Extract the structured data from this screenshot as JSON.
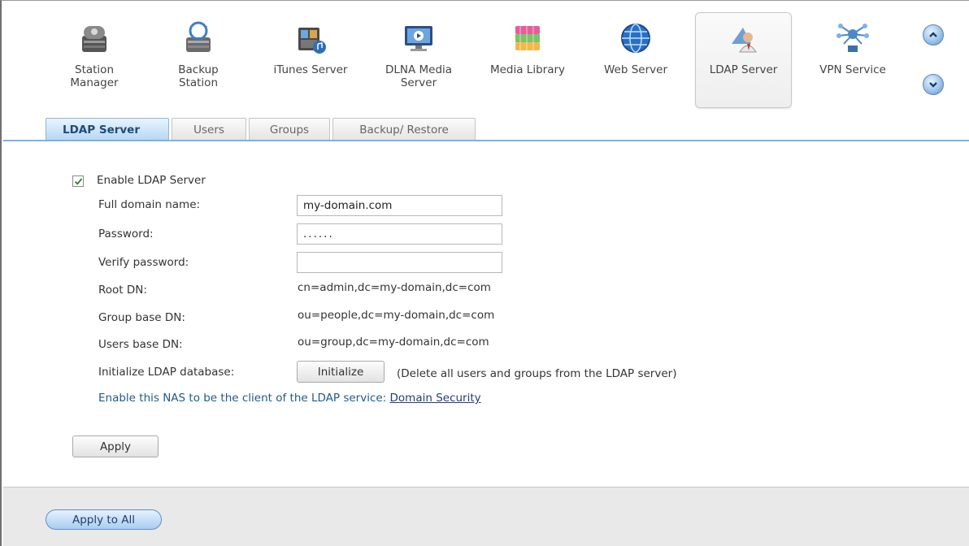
{
  "apps": [
    {
      "name": "station-manager",
      "label": "Station\nManager",
      "icon": "station-manager-icon"
    },
    {
      "name": "backup-station",
      "label": "Backup\nStation",
      "icon": "backup-station-icon"
    },
    {
      "name": "itunes-server",
      "label": "iTunes Server",
      "icon": "itunes-server-icon"
    },
    {
      "name": "dlna-media-server",
      "label": "DLNA Media\nServer",
      "icon": "dlna-media-server-icon"
    },
    {
      "name": "media-library",
      "label": "Media Library",
      "icon": "media-library-icon"
    },
    {
      "name": "web-server",
      "label": "Web Server",
      "icon": "web-server-icon"
    },
    {
      "name": "ldap-server",
      "label": "LDAP Server",
      "icon": "ldap-server-icon",
      "active": true
    },
    {
      "name": "vpn-service",
      "label": "VPN Service",
      "icon": "vpn-service-icon"
    }
  ],
  "tabs": [
    {
      "label": "LDAP Server",
      "active": true
    },
    {
      "label": "Users"
    },
    {
      "label": "Groups"
    },
    {
      "label": "Backup/ Restore"
    }
  ],
  "form": {
    "enable_label": "Enable LDAP Server",
    "enable_checked": true,
    "domain_label": "Full domain name:",
    "domain_value": "my-domain.com",
    "password_label": "Password:",
    "password_value": "......",
    "verify_label": "Verify password:",
    "verify_value": "",
    "root_dn_label": "Root DN:",
    "root_dn_value": "cn=admin,dc=my-domain,dc=com",
    "group_dn_label": "Group base DN:",
    "group_dn_value": "ou=people,dc=my-domain,dc=com",
    "users_dn_label": "Users base DN:",
    "users_dn_value": "ou=group,dc=my-domain,dc=com",
    "init_label": "Initialize LDAP database:",
    "init_button": "Initialize",
    "init_note": "(Delete all users and groups from the LDAP server)",
    "client_text": "Enable this NAS to be the client of the LDAP service: ",
    "client_link": "Domain Security",
    "apply_button": "Apply"
  },
  "footer": {
    "apply_all_button": "Apply to All"
  },
  "colors": {
    "tab_active": "#b5d6f3",
    "link": "#1f3f7a",
    "accent": "#7fb0de"
  }
}
